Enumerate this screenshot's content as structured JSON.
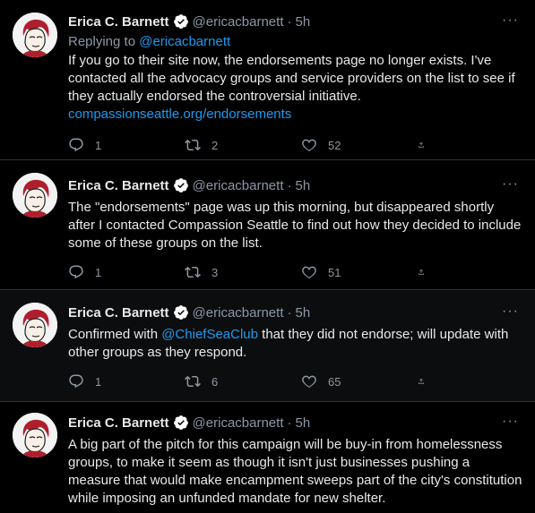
{
  "tweets": [
    {
      "author": "Erica C. Barnett",
      "handle": "@ericacbarnett",
      "separator": "·",
      "time": "5h",
      "more": "···",
      "replying_prefix": "Replying to ",
      "replying_to": "@ericacbarnett",
      "text": "If you go to their site now, the endorsements page no longer exists. I've contacted all the advocacy groups and service providers on the list to see if they actually endorsed the controversial initiative.",
      "link": "compassionseattle.org/endorsements",
      "replies": "1",
      "retweets": "2",
      "likes": "52"
    },
    {
      "author": "Erica C. Barnett",
      "handle": "@ericacbarnett",
      "separator": "·",
      "time": "5h",
      "more": "···",
      "text": "The \"endorsements\" page was up this morning, but disappeared shortly after I contacted Compassion Seattle to find out how they decided to include some of these groups on the list.",
      "replies": "1",
      "retweets": "3",
      "likes": "51"
    },
    {
      "author": "Erica C. Barnett",
      "handle": "@ericacbarnett",
      "separator": "·",
      "time": "5h",
      "more": "···",
      "text_before": "Confirmed with ",
      "mention": "@ChiefSeaClub",
      "text_after": " that they did not endorse; will update with other groups as they respond.",
      "replies": "1",
      "retweets": "6",
      "likes": "65"
    },
    {
      "author": "Erica C. Barnett",
      "handle": "@ericacbarnett",
      "separator": "·",
      "time": "5h",
      "more": "···",
      "text": "A big part of the pitch for this campaign will be buy-in from homelessness groups, to make it seem as though it isn't just businesses pushing a measure that would make encampment sweeps part of the city's constitution while imposing an unfunded mandate for new shelter."
    }
  ],
  "colors": {
    "background": "#000000",
    "accent": "#1d9bf0",
    "muted": "#8b98a5",
    "verified": "#ffffff"
  }
}
